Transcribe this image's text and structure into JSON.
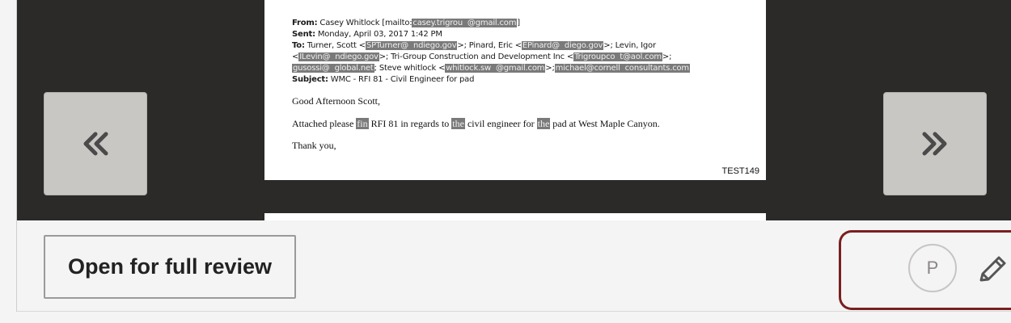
{
  "document": {
    "from_label": "From:",
    "from_name": "Casey Whitlock [mailto:",
    "from_email": "casey.trigrou  @gmail.com",
    "from_close": "]",
    "sent_label": "Sent:",
    "sent_value": "Monday, April 03, 2017 1:42 PM",
    "to_label": "To:",
    "to_part1": "Turner, Scott <",
    "to_email1": "SPTurner@  ndiego.gov",
    "to_part2": ">; Pinard, Eric <",
    "to_email2": "EPinard@  diego.gov",
    "to_part3": ">; Levin, Igor",
    "to2_open": "<",
    "to2_email1": "ILevin@  ndiego.gov",
    "to2_part2": ">; Tri-Group Construction and Development Inc <",
    "to2_email2": "Trigroupco  t@aol.com",
    "to2_part3": ">;",
    "to3_email1": "gusossi@  global.net",
    "to3_part2": "; Steve whitlock <",
    "to3_email2": "whitlock.sw  @gmail.com",
    "to3_part3": ">;",
    "to3_email3": "michael@cornell  consultants.com",
    "subject_label": "Subject:",
    "subject_value": "WMC - RFI 81 - Civil Engineer for pad",
    "greeting": "Good Afternoon Scott,",
    "line_a": "Attached please",
    "line_redact1": "fin",
    "line_b": "RFI 81 in regards to",
    "line_redact2": "the",
    "line_c": "civil engineer for",
    "line_redact3": "the",
    "line_d": "pad at West Maple Canyon.",
    "closing": "Thank you,",
    "stamp": "TEST149"
  },
  "nav": {
    "prev_icon": "«",
    "next_icon": "»"
  },
  "footer": {
    "review_button": "Open for full review",
    "avatar_initial": "P"
  },
  "colors": {
    "viewer_bg": "#2b2a28",
    "nav_button_bg": "#c9c7c4",
    "focus_ring": "#7a1f1f",
    "redaction": "#7a7a7a"
  }
}
